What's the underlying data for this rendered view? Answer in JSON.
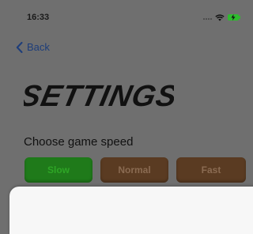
{
  "status_bar": {
    "time": "16:33"
  },
  "nav": {
    "back_label": "Back"
  },
  "page": {
    "title": "SETTINGS",
    "speed_prompt": "Choose game speed"
  },
  "speed_options": [
    {
      "label": "Slow",
      "selected": true
    },
    {
      "label": "Normal",
      "selected": false
    },
    {
      "label": "Fast",
      "selected": false
    }
  ],
  "icons": {
    "back": "chevron-left-icon",
    "wifi": "wifi-icon",
    "battery": "battery-charging-icon",
    "signal": "signal-icon"
  },
  "colors": {
    "overlay_background": "#6f6f6f",
    "back_link": "#1d3d7a",
    "slow_button": "#1f7a1a",
    "speed_button": "#5a3b22",
    "battery": "#2fba2f",
    "sheet": "#f7f7f7"
  }
}
